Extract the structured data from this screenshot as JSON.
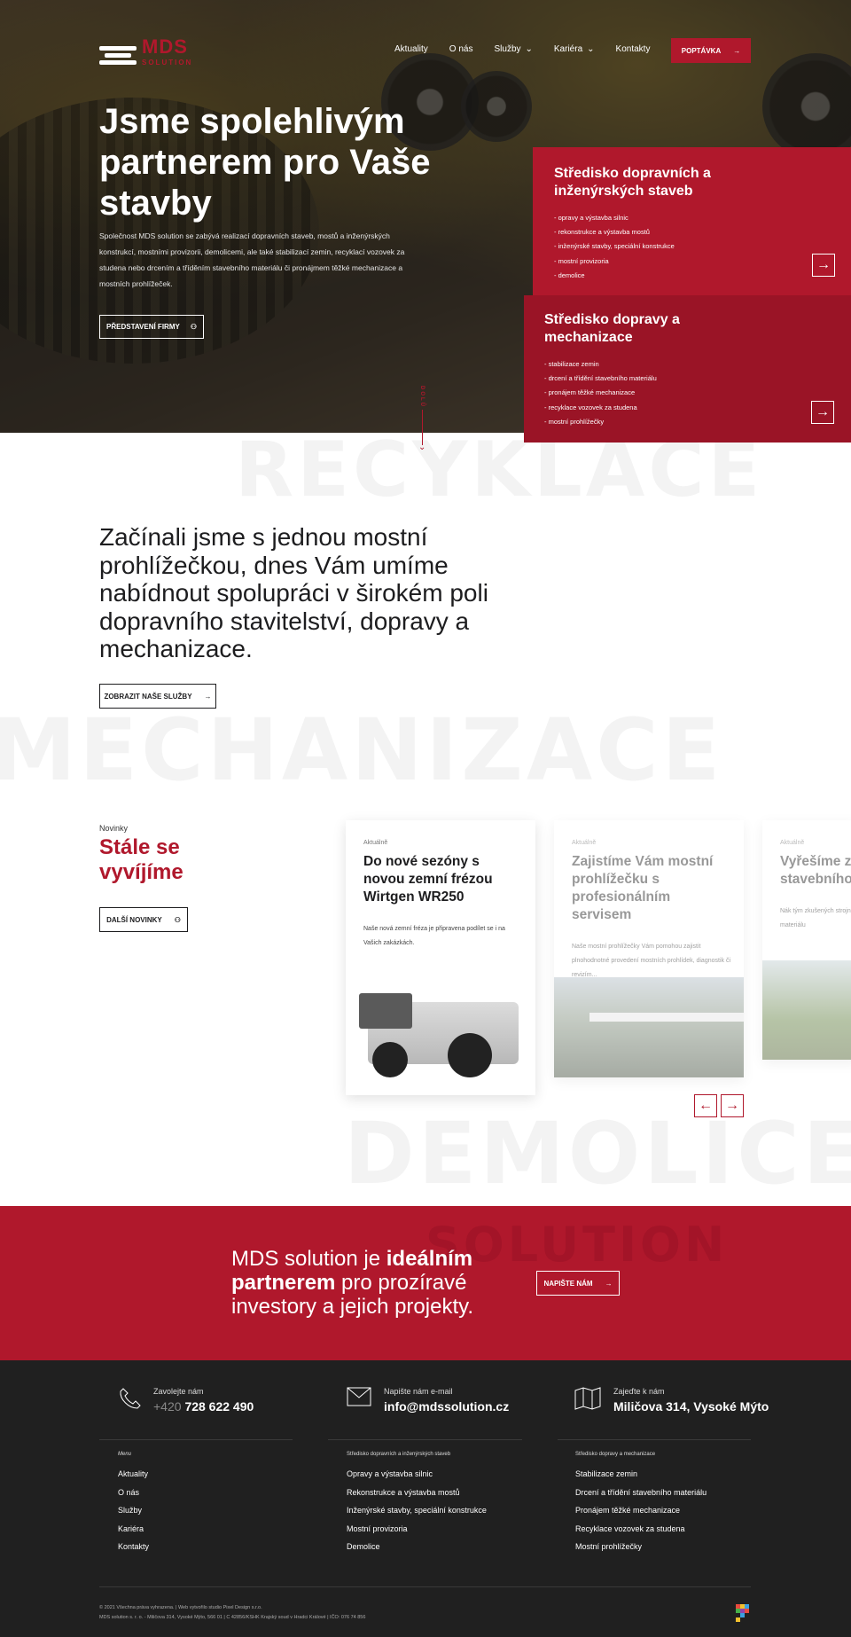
{
  "brand": {
    "name": "MDS",
    "sub": "SOLUTION"
  },
  "nav": {
    "items": [
      {
        "label": "Aktuality"
      },
      {
        "label": "O nás"
      },
      {
        "label": "Služby",
        "dropdown": true
      },
      {
        "label": "Kariéra",
        "dropdown": true
      },
      {
        "label": "Kontakty"
      }
    ],
    "cta": "POPTÁVKA"
  },
  "hero": {
    "title": "Jsme spolehlivým partnerem pro Vaše stavby",
    "text": "Společnost MDS solution se zabývá realizací dopravních staveb, mostů a inženýrských konstrukcí, mostními provizorii, demolicemi, ale také stabilizací zemin, recyklací vozovek za studena nebo drcením a tříděním stavebního materiálu či pronájmem těžké mechanizace a mostních prohlížeček.",
    "button": "PŘEDSTAVENÍ FIRMY",
    "scroll": "DOLŮ"
  },
  "divisions": [
    {
      "title": "Středisko dopravních a inženýrských staveb",
      "items": [
        "- opravy a výstavba silnic",
        "- rekonstrukce a výstavba mostů",
        "- inženýrské stavby, speciální konstrukce",
        "- mostní provizoria",
        "- demolice"
      ]
    },
    {
      "title": "Středisko dopravy a mechanizace",
      "items": [
        "- stabilizace zemin",
        "- drcení a třídění stavebního materiálu",
        "- pronájem těžké mechanizace",
        "- recyklace vozovek za studena",
        "- mostní prohlížečky"
      ]
    }
  ],
  "watermarks": {
    "w1": "RECYKLACE",
    "w2": "MECHANIZACE",
    "w3": "DEMOLICE",
    "w4": "SOLUTION"
  },
  "about": {
    "text": "Začínali jsme s jednou mostní prohlížečkou, dnes Vám umíme nabídnout spolupráci v širokém poli dopravního stavitelství, dopravy a mechanizace.",
    "button": "ZOBRAZIT NAŠE SLUŽBY"
  },
  "news": {
    "kicker": "Novinky",
    "title": "Stále se vyvíjíme",
    "button": "DALŠÍ NOVINKY",
    "cards": [
      {
        "cat": "Aktuálně",
        "title": "Do nové sezóny s novou zemní frézou Wirtgen WR250",
        "text": "Naše nová zemní fréza je připravena podílet se i na Vašich zakázkách."
      },
      {
        "cat": "Aktuálně",
        "title": "Zajistíme Vám mostní prohlížečku s profesionálním servisem",
        "text": "Naše mostní prohlížečky Vám pomohou zajistit plnohodnotné provedení mostních prohlídek, diagnostik či revizím..."
      },
      {
        "cat": "Aktuálně",
        "title": "Vyřešíme za Vás i stavebního odpadu",
        "text": "Nák tým zkušených strojníků... roztřídění stavebního materiálu"
      }
    ]
  },
  "cta": {
    "pre": "MDS solution je ",
    "bold": "ideálním partnerem",
    "post": " pro prozíravé investory a jejich projekty.",
    "button": "NAPIŠTE NÁM"
  },
  "footer": {
    "contacts": [
      {
        "label": "Zavolejte nám",
        "prefix": "+420",
        "value": "728 622 490",
        "icon": "phone-icon"
      },
      {
        "label": "Napište nám e-mail",
        "value": "info@mdssolution.cz",
        "icon": "mail-icon"
      },
      {
        "label": "Zajeďte k nám",
        "value": "Miličova 314, Vysoké Mýto",
        "icon": "map-icon"
      }
    ],
    "menus": [
      {
        "title": "Menu",
        "items": [
          "Aktuality",
          "O nás",
          "Služby",
          "Kariéra",
          "Kontakty"
        ]
      },
      {
        "title": "Středisko dopravních a inženýrských staveb",
        "items": [
          "Opravy a výstavba silnic",
          "Rekonstrukce a výstavba mostů",
          "Inženýrské stavby, speciální konstrukce",
          "Mostní provizoria",
          "Demolice"
        ]
      },
      {
        "title": "Středisko dopravy a mechanizace",
        "items": [
          "Stabilizace zemin",
          "Drcení a třídění stavebního materiálu",
          "Pronájem těžké mechanizace",
          "Recyklace vozovek za studena",
          "Mostní prohlížečky"
        ]
      }
    ],
    "copy1": "© 2021 Všechna práva vyhrazena.  |  Web vytvořilo studio Pixel Design s.r.o.",
    "copy2": "MDS solution s. r. o. - Miličova 314, Vysoké Mýto, 566 01  |  C 42856/KSHK Krajský soud v Hradci Králové  |  IČO: 076 74 856"
  },
  "colors": {
    "accent": "#b0182c",
    "dark": "#202020"
  }
}
